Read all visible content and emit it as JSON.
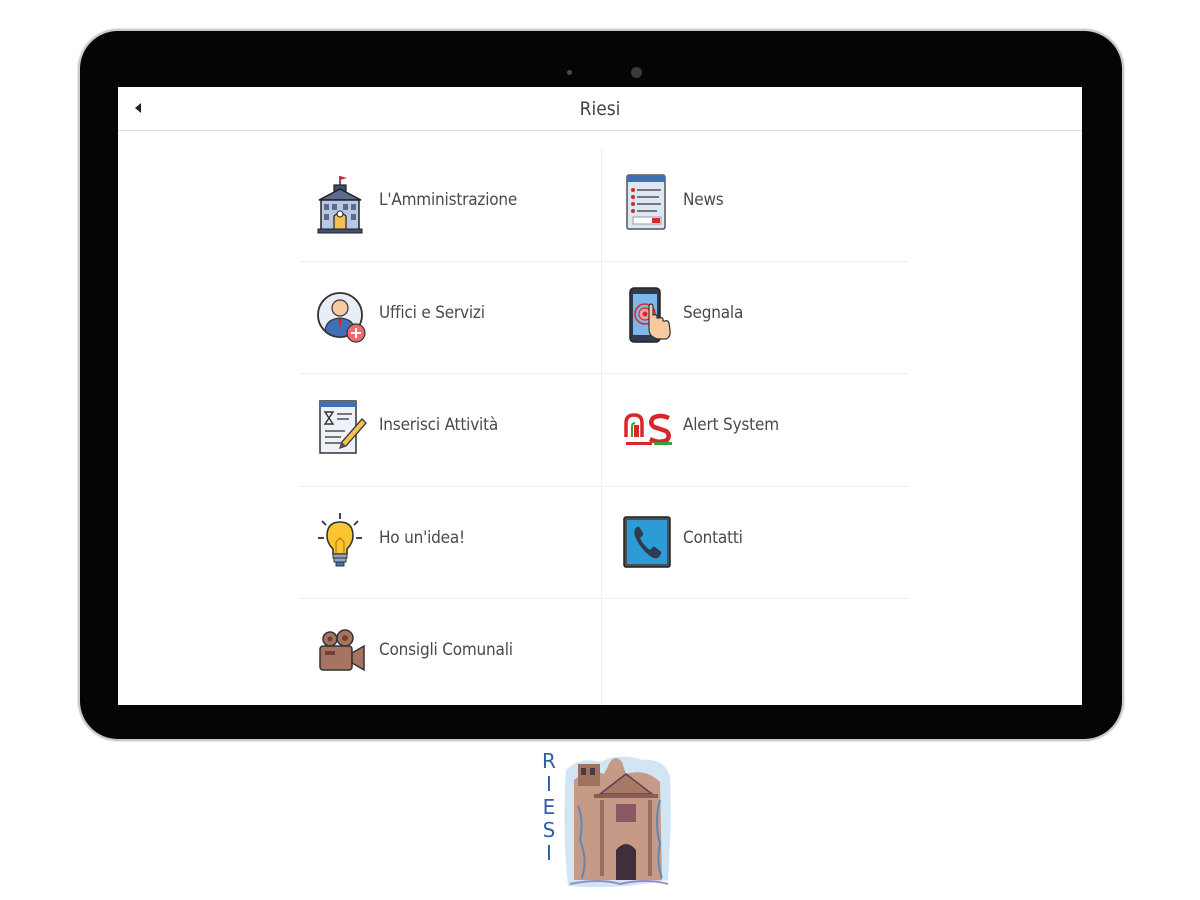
{
  "header": {
    "title": "Riesi",
    "back_icon": "back-arrow-icon"
  },
  "menu": [
    {
      "label": "L'Amministrazione",
      "icon": "town-hall-icon"
    },
    {
      "label": "News",
      "icon": "news-document-icon"
    },
    {
      "label": "Uffici e Servizi",
      "icon": "office-user-icon"
    },
    {
      "label": "Segnala",
      "icon": "phone-tap-icon"
    },
    {
      "label": "Inserisci Attività",
      "icon": "form-edit-icon"
    },
    {
      "label": "Alert System",
      "icon": "alert-system-logo-icon"
    },
    {
      "label": "Ho un'idea!",
      "icon": "lightbulb-icon"
    },
    {
      "label": "Contatti",
      "icon": "phone-contact-icon"
    },
    {
      "label": "Consigli Comunali",
      "icon": "video-camera-icon"
    }
  ],
  "logo": {
    "letters": [
      "R",
      "I",
      "E",
      "S",
      "I"
    ]
  },
  "colors": {
    "accent_red": "#d9262b",
    "accent_green": "#3d9e3a",
    "accent_blue": "#2e5fa8"
  }
}
